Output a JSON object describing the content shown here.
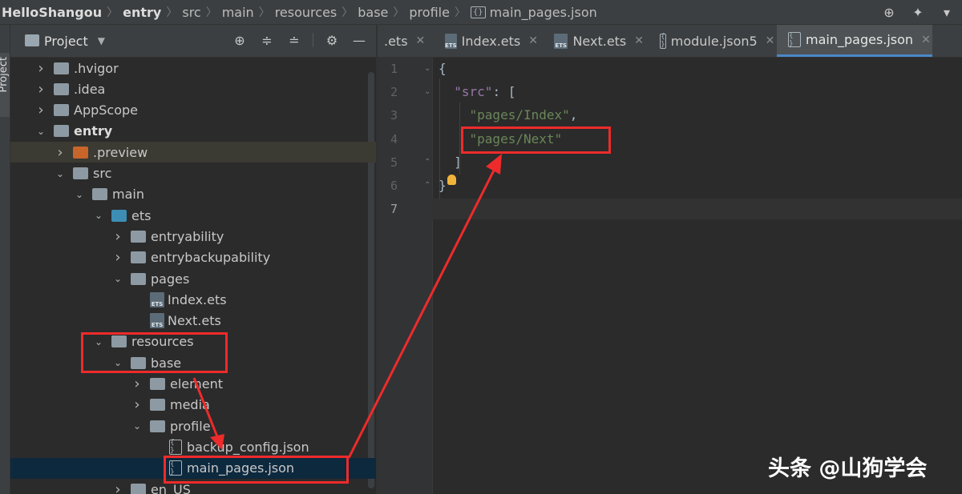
{
  "breadcrumb": [
    {
      "label": "HelloShangou",
      "bold": true
    },
    {
      "label": "entry",
      "bold": true
    },
    {
      "label": "src",
      "bold": false
    },
    {
      "label": "main",
      "bold": false
    },
    {
      "label": "resources",
      "bold": false
    },
    {
      "label": "base",
      "bold": false
    },
    {
      "label": "profile",
      "bold": false
    },
    {
      "label": "main_pages.json",
      "bold": false
    }
  ],
  "side_strip_label": "Project",
  "project_panel": {
    "title": "Project",
    "tree": [
      {
        "label": ".hvigor",
        "indent": 0,
        "expanded": false
      },
      {
        "label": ".idea",
        "indent": 0,
        "expanded": false
      },
      {
        "label": "AppScope",
        "indent": 0,
        "expanded": false
      },
      {
        "label": "entry",
        "indent": 0,
        "expanded": true,
        "bold": true
      },
      {
        "label": ".preview",
        "indent": 1,
        "expanded": false
      },
      {
        "label": "src",
        "indent": 1,
        "expanded": true
      },
      {
        "label": "main",
        "indent": 2,
        "expanded": true
      },
      {
        "label": "ets",
        "indent": 3,
        "expanded": true
      },
      {
        "label": "entryability",
        "indent": 4,
        "expanded": false
      },
      {
        "label": "entrybackupability",
        "indent": 4,
        "expanded": false
      },
      {
        "label": "pages",
        "indent": 4,
        "expanded": true
      },
      {
        "label": "Index.ets",
        "indent": 5
      },
      {
        "label": "Next.ets",
        "indent": 5
      },
      {
        "label": "resources",
        "indent": 3,
        "expanded": true
      },
      {
        "label": "base",
        "indent": 4,
        "expanded": true
      },
      {
        "label": "element",
        "indent": 5,
        "expanded": false
      },
      {
        "label": "media",
        "indent": 5,
        "expanded": false
      },
      {
        "label": "profile",
        "indent": 5,
        "expanded": true
      },
      {
        "label": "backup_config.json",
        "indent": 6
      },
      {
        "label": "main_pages.json",
        "indent": 6
      },
      {
        "label": "en_US",
        "indent": 4,
        "expanded": false
      }
    ]
  },
  "tabs": [
    {
      "label": ".ets"
    },
    {
      "label": "Index.ets"
    },
    {
      "label": "Next.ets"
    },
    {
      "label": "module.json5"
    },
    {
      "label": "main_pages.json"
    }
  ],
  "icon_text": {
    "ets": "ETS",
    "json": "{ }"
  },
  "editor": {
    "line_numbers": [
      "1",
      "2",
      "3",
      "4",
      "5",
      "6",
      "7"
    ],
    "lines": [
      [
        {
          "t": "{",
          "c": "br"
        }
      ],
      [
        {
          "t": "  ",
          "c": "br"
        },
        {
          "t": "\"src\"",
          "c": "key"
        },
        {
          "t": ": [",
          "c": "br"
        }
      ],
      [
        {
          "t": "    ",
          "c": "br"
        },
        {
          "t": "\"pages/Index\"",
          "c": "str"
        },
        {
          "t": ",",
          "c": "br"
        }
      ],
      [
        {
          "t": "    ",
          "c": "br"
        },
        {
          "t": "\"pages/Next\"",
          "c": "str"
        }
      ],
      [
        {
          "t": "  ]",
          "c": "br"
        }
      ],
      [
        {
          "t": "}",
          "c": "br"
        }
      ],
      [
        {
          "t": "",
          "c": "br"
        }
      ]
    ]
  },
  "watermark": "头条 @山狗学会",
  "colors": {
    "annotation": "#ee2b2b",
    "selection": "#0d293e",
    "accent": "#4a88c7"
  }
}
